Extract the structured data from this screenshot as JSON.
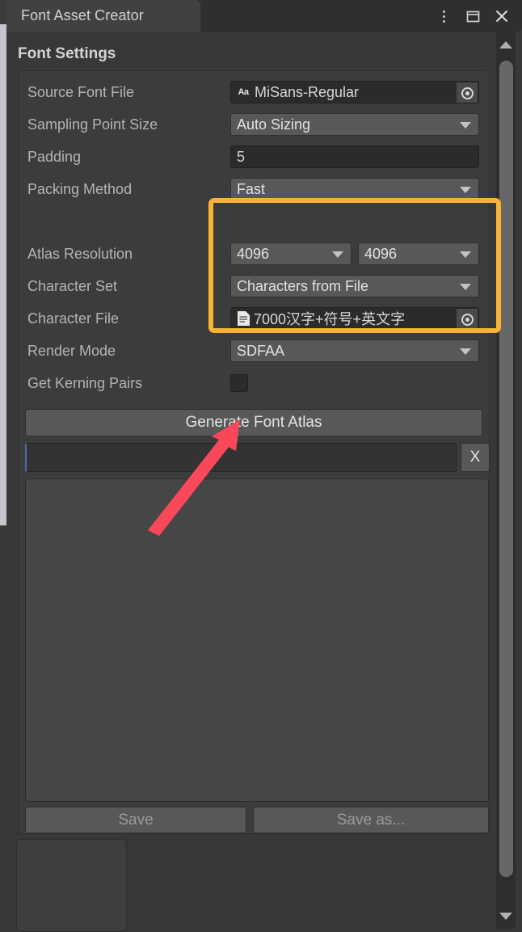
{
  "window": {
    "tab_title": "Font Asset Creator",
    "menu_icon": "kebab-menu-icon",
    "maximize_icon": "maximize-icon",
    "close_icon": "close-icon"
  },
  "section": {
    "title": "Font Settings"
  },
  "fields": {
    "source_font_file": {
      "label": "Source Font File",
      "value": "MiSans-Regular",
      "icon": "font-asset-icon",
      "icon_text": "Aa",
      "picker_icon": "object-picker-icon"
    },
    "sampling_point_size": {
      "label": "Sampling Point Size",
      "value": "Auto Sizing"
    },
    "padding": {
      "label": "Padding",
      "value": "5"
    },
    "packing_method": {
      "label": "Packing Method",
      "value": "Fast"
    },
    "atlas_resolution": {
      "label": "Atlas Resolution",
      "width_value": "4096",
      "height_value": "4096"
    },
    "character_set": {
      "label": "Character Set",
      "value": "Characters from File"
    },
    "character_file": {
      "label": "Character File",
      "value": "7000汉字+符号+英文字",
      "icon": "text-asset-icon",
      "picker_icon": "object-picker-icon"
    },
    "render_mode": {
      "label": "Render Mode",
      "value": "SDFAA"
    },
    "get_kerning_pairs": {
      "label": "Get Kerning Pairs",
      "checked": false
    }
  },
  "buttons": {
    "generate": "Generate Font Atlas",
    "clear_status": "X",
    "save": "Save",
    "save_as": "Save as..."
  },
  "status": {
    "text": ""
  },
  "annotations": {
    "highlight_color": "#f9b233",
    "arrow_color": "#f9485a"
  }
}
